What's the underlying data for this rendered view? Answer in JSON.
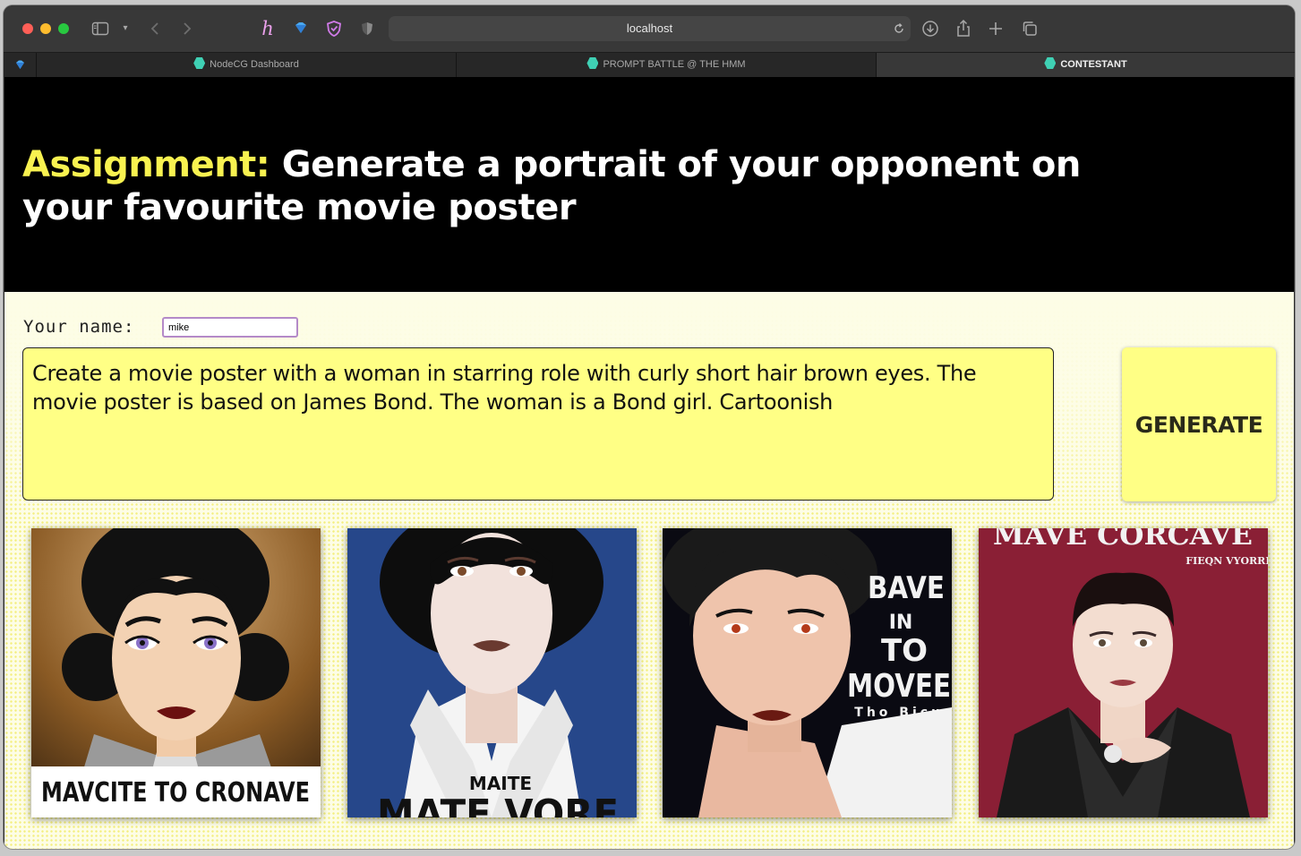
{
  "browser": {
    "url": "localhost",
    "tabs": [
      {
        "label": "NodeCG Dashboard",
        "active": false
      },
      {
        "label": "PROMPT BATTLE @ THE HMM",
        "active": false
      },
      {
        "label": "CONTESTANT",
        "active": true
      }
    ]
  },
  "header": {
    "assignment_label": "Assignment:",
    "assignment_text": "Generate a portrait of your opponent on your favourite movie poster"
  },
  "form": {
    "name_label": "Your name:",
    "name_value": "mike",
    "prompt_text": "Create a movie poster with a woman in starring role with curly short hair brown eyes. The movie poster is based on James Bond. The woman is a Bond girl. Cartoonish",
    "generate_label": "GENERATE"
  },
  "posters": [
    {
      "caption": "MAVCITE TO CRONAVE"
    },
    {
      "caption_small": "MAITE",
      "caption": "MATE VORE"
    },
    {
      "lines": [
        "BAVE",
        "IN",
        "TO",
        "MOVEE",
        "Tho Bicн"
      ]
    },
    {
      "title": "MAVE CORCAVE",
      "subtitle": "FIEQN VYORRE"
    }
  ],
  "colors": {
    "accent_yellow": "#f8f250",
    "input_yellow": "#ffff85",
    "header_bg": "#000000"
  }
}
